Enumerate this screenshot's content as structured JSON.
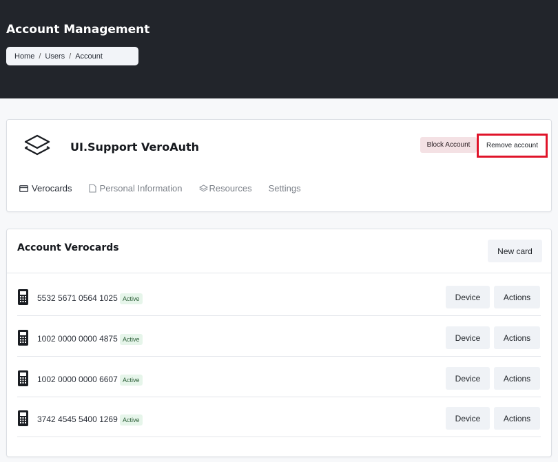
{
  "header": {
    "title": "Account Management",
    "breadcrumb": [
      "Home",
      "Users",
      "Account"
    ]
  },
  "account": {
    "name": "UI.Support VeroAuth",
    "block_label": "Block Account",
    "remove_label": "Remove account",
    "logo_icon": "layers-icon",
    "highlight_color": "#e0142a"
  },
  "tabs": [
    {
      "label": "Verocards",
      "icon": "card-icon",
      "active": true
    },
    {
      "label": "Personal Information",
      "icon": "document-icon",
      "active": false
    },
    {
      "label": "Resources",
      "icon": "layers-icon",
      "active": false
    },
    {
      "label": "Settings",
      "icon": "",
      "active": false
    }
  ],
  "verocards": {
    "title": "Account Verocards",
    "new_card_label": "New card",
    "rows": [
      {
        "number": "5532 5671 0564 1025",
        "status": "Active",
        "device_label": "Device",
        "actions_label": "Actions"
      },
      {
        "number": "1002 0000 0000 4875",
        "status": "Active",
        "device_label": "Device",
        "actions_label": "Actions"
      },
      {
        "number": "1002 0000 0000 6607",
        "status": "Active",
        "device_label": "Device",
        "actions_label": "Actions"
      },
      {
        "number": "3742 4545 5400 1269",
        "status": "Active",
        "device_label": "Device",
        "actions_label": "Actions"
      }
    ]
  }
}
